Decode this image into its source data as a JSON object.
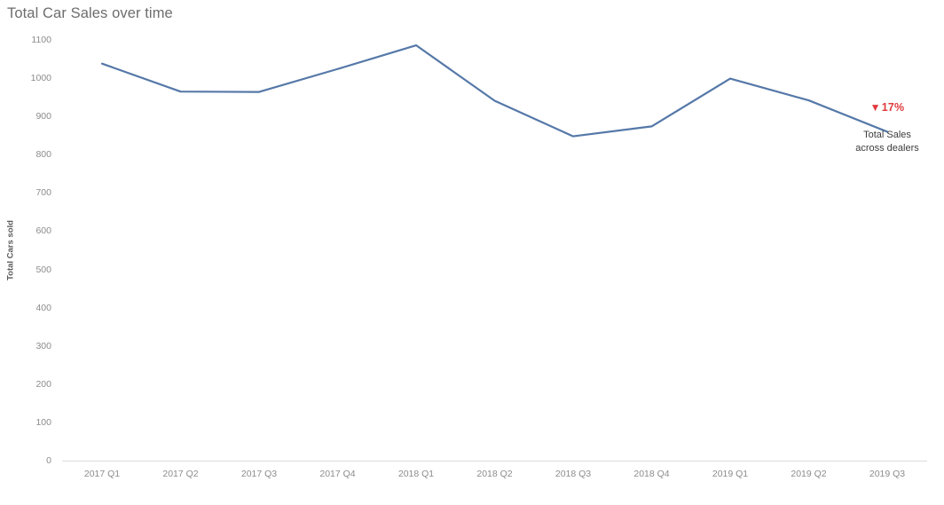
{
  "chart_data": {
    "type": "line",
    "title": "Total Car Sales over time",
    "xlabel": "",
    "ylabel": "Total Cars sold",
    "categories": [
      "2017 Q1",
      "2017 Q2",
      "2017 Q3",
      "2017 Q4",
      "2018 Q1",
      "2018 Q2",
      "2018 Q3",
      "2018 Q4",
      "2019 Q1",
      "2019 Q2",
      "2019 Q3"
    ],
    "values": [
      1038,
      965,
      964,
      1024,
      1086,
      941,
      848,
      874,
      999,
      942,
      860
    ],
    "series": [
      {
        "name": "Total Cars sold",
        "color": "#5578a8",
        "values": [
          1038,
          965,
          964,
          1024,
          1086,
          941,
          848,
          874,
          999,
          942,
          860
        ]
      }
    ],
    "ylim": [
      0,
      1100
    ],
    "yticks": [
      1100,
      1000,
      900,
      800,
      700,
      600,
      500,
      400,
      300,
      200,
      100,
      0
    ],
    "ytick_labels": [
      "1100",
      "1000",
      "900",
      "800",
      "700",
      "600",
      "500",
      "400",
      "300",
      "200",
      "100",
      "0"
    ],
    "grid": false,
    "legend": "none",
    "annotations": [
      {
        "name": "percent-change",
        "arrow_glyph": "▼",
        "value": "17%",
        "caption_line1": "Total Sales",
        "caption_line2": "across dealers",
        "color": "#e0393e",
        "anchor_category": "2019 Q3"
      }
    ]
  },
  "colors": {
    "line": "#5578a8",
    "title_text": "#6d6d6d",
    "tick_text": "#8c8c8c",
    "axis_rule": "#dcdcdc",
    "negative": "#e0393e",
    "caption_text": "#3c3c3c",
    "background": "#ffffff"
  }
}
